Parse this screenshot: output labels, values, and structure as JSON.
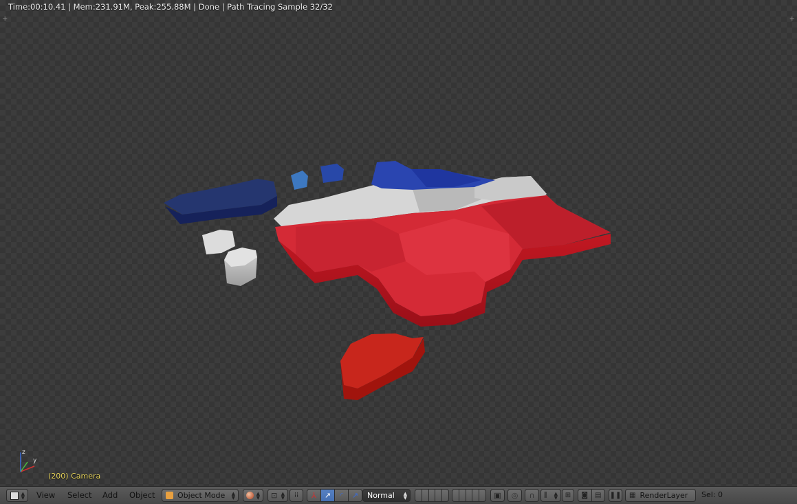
{
  "render_info": {
    "status": "Time:00:10.41 | Mem:231.91M, Peak:255.88M | Done | Path Tracing Sample 32/32"
  },
  "viewport": {
    "object_label": "(200) Camera",
    "axis_labels": {
      "x": "x",
      "y": "y",
      "z": "z"
    }
  },
  "header": {
    "menus": {
      "view": "View",
      "select": "Select",
      "add": "Add",
      "object": "Object"
    },
    "mode": "Object Mode",
    "orientation": "Normal",
    "render_layer": "RenderLayer",
    "selection": "Sel: 0"
  },
  "colors": {
    "viewport_bg": "#3c3c3c",
    "header_bg": "#4f4f4f",
    "active_button": "#5680c2",
    "label_yellow": "#e6d35a",
    "map_red": "#d42a36",
    "map_white": "#d8d8d8",
    "map_blue": "#1f3f9a",
    "map_navy": "#1e2e66"
  }
}
